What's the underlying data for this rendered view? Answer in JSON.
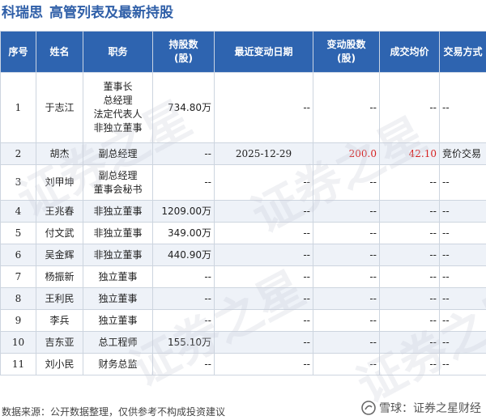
{
  "title": {
    "company": "科瑞思",
    "subject": "高管列表及最新持股"
  },
  "columns": [
    "序号",
    "姓名",
    "职务",
    "持股数\n(股)",
    "最近变动日期",
    "变动股数\n(股)",
    "成交均价",
    "交易方式"
  ],
  "rows": [
    {
      "no": "1",
      "name": "于志江",
      "positions": [
        "董事长",
        "总经理",
        "法定代表人",
        "非独立董事"
      ],
      "shares": "734.80万",
      "date": "--",
      "change": "--",
      "price": "--",
      "method": "--"
    },
    {
      "no": "2",
      "name": "胡杰",
      "positions": [
        "副总经理"
      ],
      "shares": "--",
      "date": "2025-12-29",
      "change": "200.0",
      "price": "42.10",
      "method": "竞价交易"
    },
    {
      "no": "3",
      "name": "刘甲坤",
      "positions": [
        "副总经理",
        "董事会秘书"
      ],
      "shares": "--",
      "date": "--",
      "change": "--",
      "price": "--",
      "method": "--"
    },
    {
      "no": "4",
      "name": "王兆春",
      "positions": [
        "非独立董事"
      ],
      "shares": "1209.00万",
      "date": "--",
      "change": "--",
      "price": "--",
      "method": "--"
    },
    {
      "no": "5",
      "name": "付文武",
      "positions": [
        "非独立董事"
      ],
      "shares": "349.00万",
      "date": "--",
      "change": "--",
      "price": "--",
      "method": "--"
    },
    {
      "no": "6",
      "name": "吴金辉",
      "positions": [
        "非独立董事"
      ],
      "shares": "440.90万",
      "date": "--",
      "change": "--",
      "price": "--",
      "method": "--"
    },
    {
      "no": "7",
      "name": "杨振新",
      "positions": [
        "独立董事"
      ],
      "shares": "--",
      "date": "--",
      "change": "--",
      "price": "--",
      "method": "--"
    },
    {
      "no": "8",
      "name": "王利民",
      "positions": [
        "独立董事"
      ],
      "shares": "--",
      "date": "--",
      "change": "--",
      "price": "--",
      "method": "--"
    },
    {
      "no": "9",
      "name": "李兵",
      "positions": [
        "独立董事"
      ],
      "shares": "--",
      "date": "--",
      "change": "--",
      "price": "--",
      "method": "--"
    },
    {
      "no": "10",
      "name": "吉东亚",
      "positions": [
        "总工程师"
      ],
      "shares": "155.10万",
      "date": "--",
      "change": "--",
      "price": "--",
      "method": "--"
    },
    {
      "no": "11",
      "name": "刘小民",
      "positions": [
        "财务总监"
      ],
      "shares": "--",
      "date": "--",
      "change": "--",
      "price": "--",
      "method": "--"
    }
  ],
  "footer": "数据来源：公开数据整理，仅供参考不构成投资建议",
  "brand": "雪球：证券之星财经",
  "watermark": "证券之星",
  "colors": {
    "header_bg": "#2e64b0",
    "title": "#2f5fa8",
    "highlight": "#d62020",
    "stripe": "#eef2f8"
  },
  "highlight_cells": [
    {
      "row": 1,
      "fields": [
        "change",
        "price"
      ]
    }
  ]
}
